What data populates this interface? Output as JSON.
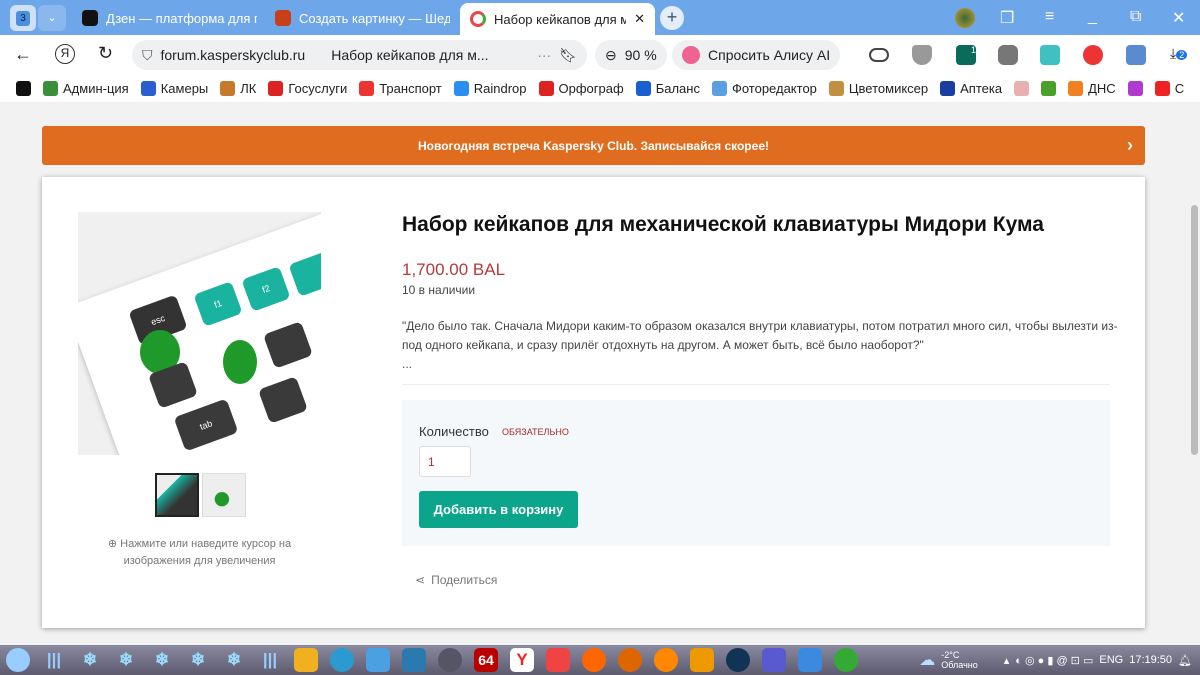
{
  "browser": {
    "tab_count": "3",
    "tabs": [
      {
        "label": "Дзен — платформа для п"
      },
      {
        "label": "Создать картинку — Шед"
      },
      {
        "label": "Набор кейкапов для ме"
      }
    ],
    "url": "forum.kasperskyclub.ru",
    "page_title": "Набор кейкапов для м...",
    "zoom": "90 %",
    "alice": "Спросить Алису AI",
    "badges": {
      "ext1": "1",
      "downloads": "2"
    },
    "bookmarks": [
      {
        "label": "Админ-ция",
        "color": "#3a8f3a"
      },
      {
        "label": "Камеры",
        "color": "#2a5fd0"
      },
      {
        "label": "ЛК",
        "color": "#c47a2a"
      },
      {
        "label": "Госуслуги",
        "color": "#d22"
      },
      {
        "label": "Транспорт",
        "color": "#e33"
      },
      {
        "label": "Raindrop",
        "color": "#2a8ff0"
      },
      {
        "label": "Орфограф",
        "color": "#d22"
      },
      {
        "label": "Баланс",
        "color": "#1a5fd0"
      },
      {
        "label": "Фоторедактор",
        "color": "#5aa0e0"
      },
      {
        "label": "Цветомиксер",
        "color": "#c09040"
      },
      {
        "label": "Аптека",
        "color": "#1a3fa0"
      },
      {
        "label": "",
        "color": "#e8b0b0"
      },
      {
        "label": "",
        "color": "#4aa02a"
      },
      {
        "label": "ДНС",
        "color": "#f08020"
      },
      {
        "label": "",
        "color": "#b03ad0"
      },
      {
        "label": "С",
        "color": "#e22"
      }
    ]
  },
  "page": {
    "banner": "Новогодняя встреча Kaspersky Club. Записывайся скорее!",
    "title": "Набор кейкапов для механической клавиатуры Мидори Кума",
    "price": "1,700.00 BAL",
    "stock": "10 в наличии",
    "description": "\"Дело было так. Сначала Мидори каким-то образом оказался внутри клавиатуры, потом потратил много сил, чтобы вылезти из-под одного кейкапа, и сразу прилёг отдохнуть на другом. А может быть, всё было наоборот?\"",
    "ellipsis": "...",
    "quantity_label": "Количество",
    "required": "ОБЯЗАТЕЛЬНО",
    "quantity": "1",
    "add_to_cart": "Добавить в корзину",
    "share": "Поделиться",
    "zoom_hint": "Нажмите или наведите курсор на изображения для увеличения",
    "image_keys": {
      "esc": "esc",
      "f1": "f1",
      "f2": "f2",
      "tab": "tab"
    },
    "accent": "#0aa58a",
    "price_color": "#b23b3b",
    "banner_color": "#e06d1f"
  },
  "taskbar": {
    "app_64": "64",
    "weather_temp": "-2°C",
    "weather_text": "Облачно",
    "lang": "ENG",
    "time": "17:19:50"
  }
}
